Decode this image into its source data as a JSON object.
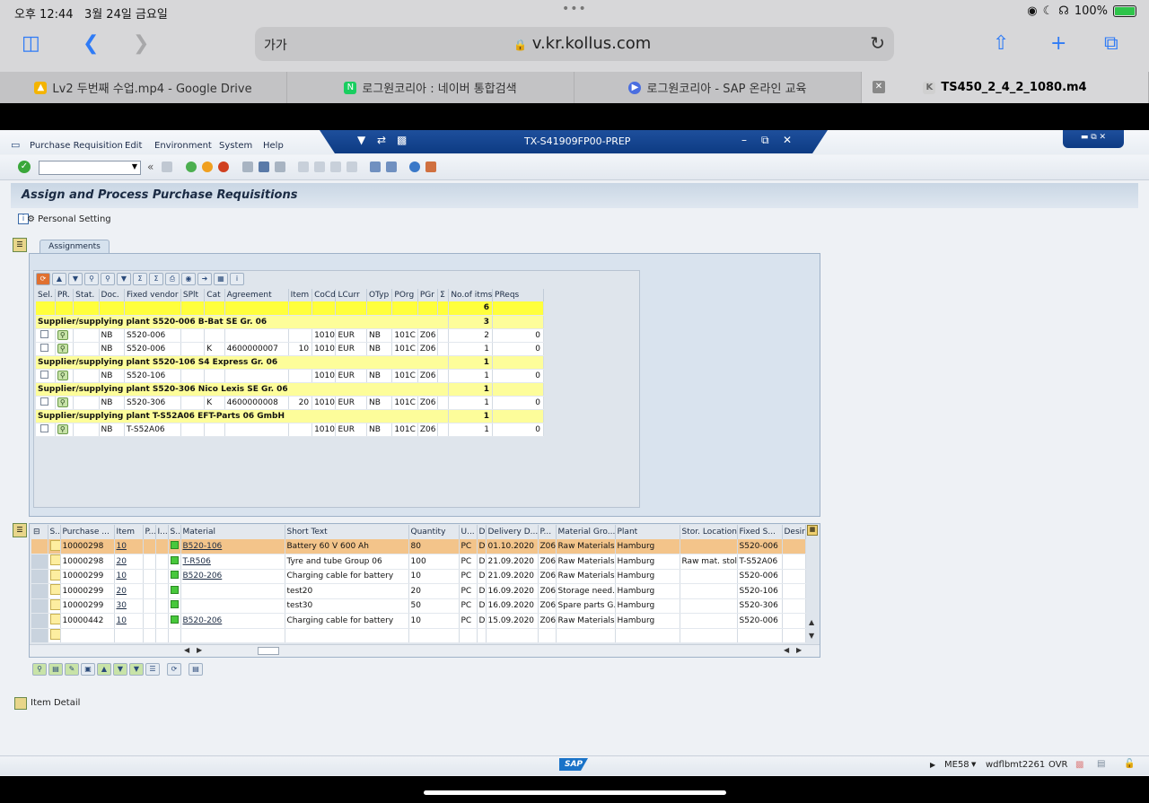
{
  "ipad": {
    "time": "오후 12:44",
    "date": "3월 24일 금요일",
    "battery": "100%",
    "url": "v.kr.kollus.com",
    "text_size": "가가"
  },
  "browser_tabs": [
    {
      "label": "Lv2 두번째 수업.mp4 - Google Drive",
      "icon": "google-drive-icon",
      "color": "#f4b400"
    },
    {
      "label": "로그원코리아 : 네이버 통합검색",
      "icon": "naver-icon",
      "color": "#19ce60"
    },
    {
      "label": "로그원코리아 - SAP 온라인 교육",
      "icon": "play-icon",
      "color": "#4a6ee0"
    },
    {
      "label": "TS450_2_4_2_1080.m4",
      "icon": "k-icon",
      "color": "#d0d0d0"
    }
  ],
  "sap": {
    "menu": [
      "Purchase Requisition",
      "Edit",
      "Environment",
      "System",
      "Help"
    ],
    "window_title": "TX-S41909FP00-PREP",
    "page_title": "Assign and Process Purchase Requisitions",
    "personal_setting": "Personal Setting",
    "assignments_tab": "Assignments",
    "item_detail": "Item Detail",
    "status": {
      "tcode": "ME58",
      "server": "wdflbmt2261",
      "mode": "OVR"
    },
    "logo": "SAP"
  },
  "assign_grid": {
    "columns": [
      "Sel.",
      "PR.",
      "Stat.",
      "Doc.",
      "Fixed vendor",
      "SPlt",
      "Cat",
      "Agreement",
      "Item",
      "CoCd",
      "LCurr",
      "OTyp",
      "POrg",
      "PGr",
      "Σ",
      "No.of itms",
      "PReqs"
    ],
    "total": "6",
    "groups": [
      {
        "label": "Supplier/supplying plant S520-006 B-Bat SE Gr. 06",
        "count": "3",
        "rows": [
          {
            "doc": "NB",
            "vendor": "S520-006",
            "cat": "",
            "agreement": "",
            "item": "",
            "cocd": "1010",
            "lcurr": "EUR",
            "otyp": "NB",
            "porg": "101C",
            "pgr": "Z06",
            "items": "2",
            "preqs": "0"
          },
          {
            "doc": "NB",
            "vendor": "S520-006",
            "cat": "K",
            "agreement": "4600000007",
            "item": "10",
            "cocd": "1010",
            "lcurr": "EUR",
            "otyp": "NB",
            "porg": "101C",
            "pgr": "Z06",
            "items": "1",
            "preqs": "0"
          }
        ]
      },
      {
        "label": "Supplier/supplying plant S520-106 S4 Express Gr. 06",
        "count": "1",
        "rows": [
          {
            "doc": "NB",
            "vendor": "S520-106",
            "cat": "",
            "agreement": "",
            "item": "",
            "cocd": "1010",
            "lcurr": "EUR",
            "otyp": "NB",
            "porg": "101C",
            "pgr": "Z06",
            "items": "1",
            "preqs": "0"
          }
        ]
      },
      {
        "label": "Supplier/supplying plant S520-306 Nico Lexis SE Gr. 06",
        "count": "1",
        "rows": [
          {
            "doc": "NB",
            "vendor": "S520-306",
            "cat": "K",
            "agreement": "4600000008",
            "item": "20",
            "cocd": "1010",
            "lcurr": "EUR",
            "otyp": "NB",
            "porg": "101C",
            "pgr": "Z06",
            "items": "1",
            "preqs": "0"
          }
        ]
      },
      {
        "label": "Supplier/supplying plant T-S52A06 EFT-Parts 06 GmbH",
        "count": "1",
        "rows": [
          {
            "doc": "NB",
            "vendor": "T-S52A06",
            "cat": "",
            "agreement": "",
            "item": "",
            "cocd": "1010",
            "lcurr": "EUR",
            "otyp": "NB",
            "porg": "101C",
            "pgr": "Z06",
            "items": "1",
            "preqs": "0"
          }
        ]
      }
    ]
  },
  "item_grid": {
    "columns": [
      "S..",
      "Purchase ...",
      "Item",
      "P...",
      "I...",
      "S...",
      "Material",
      "Short Text",
      "Quantity",
      "U...",
      "D",
      "Delivery D...",
      "P...",
      "Material Gro...",
      "Plant",
      "Stor. Location",
      "Fixed S...",
      "Desir"
    ],
    "rows": [
      {
        "pr": "10000298",
        "item": "10",
        "material": "B520-106",
        "short": "Battery 60 V 600 Ah",
        "qty": "80",
        "unit": "PC",
        "d": "D",
        "date": "01.10.2020",
        "pgr": "Z06",
        "matgrp": "Raw Materials",
        "plant": "Hamburg",
        "stor": "",
        "fixed": "S520-006",
        "selected": true
      },
      {
        "pr": "10000298",
        "item": "20",
        "material": "T-R506",
        "short": "Tyre and tube Group 06",
        "qty": "100",
        "unit": "PC",
        "d": "D",
        "date": "21.09.2020",
        "pgr": "Z06",
        "matgrp": "Raw Materials",
        "plant": "Hamburg",
        "stor": "Raw mat. stol...",
        "fixed": "T-S52A06",
        "selected": false
      },
      {
        "pr": "10000299",
        "item": "10",
        "material": "B520-206",
        "short": "Charging cable for battery",
        "qty": "10",
        "unit": "PC",
        "d": "D",
        "date": "21.09.2020",
        "pgr": "Z06",
        "matgrp": "Raw Materials",
        "plant": "Hamburg",
        "stor": "",
        "fixed": "S520-006",
        "selected": false
      },
      {
        "pr": "10000299",
        "item": "20",
        "material": "",
        "short": "test20",
        "qty": "20",
        "unit": "PC",
        "d": "D",
        "date": "16.09.2020",
        "pgr": "Z06",
        "matgrp": "Storage need...",
        "plant": "Hamburg",
        "stor": "",
        "fixed": "S520-106",
        "selected": false
      },
      {
        "pr": "10000299",
        "item": "30",
        "material": "",
        "short": "test30",
        "qty": "50",
        "unit": "PC",
        "d": "D",
        "date": "16.09.2020",
        "pgr": "Z06",
        "matgrp": "Spare parts G...",
        "plant": "Hamburg",
        "stor": "",
        "fixed": "S520-306",
        "selected": false
      },
      {
        "pr": "10000442",
        "item": "10",
        "material": "B520-206",
        "short": "Charging cable for battery",
        "qty": "10",
        "unit": "PC",
        "d": "D",
        "date": "15.09.2020",
        "pgr": "Z06",
        "matgrp": "Raw Materials",
        "plant": "Hamburg",
        "stor": "",
        "fixed": "S520-006",
        "selected": false
      }
    ]
  }
}
